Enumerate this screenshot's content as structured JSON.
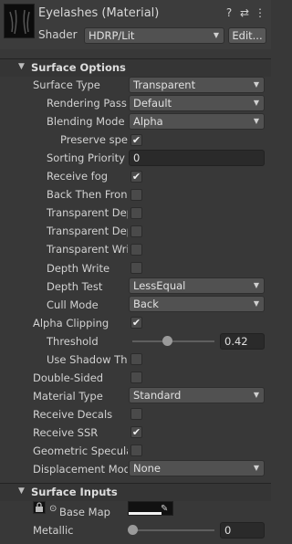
{
  "header": {
    "title": "Eyelashes (Material)",
    "help_icon": "?",
    "settings_icon": "⇄",
    "menu_icon": "⋮",
    "shader_label": "Shader",
    "shader_value": "HDRP/Lit",
    "edit_label": "Edit..."
  },
  "surface_options": {
    "title": "Surface Options",
    "surface_type": {
      "label": "Surface Type",
      "value": "Transparent"
    },
    "rendering_pass": {
      "label": "Rendering Pass",
      "value": "Default"
    },
    "blending_mode": {
      "label": "Blending Mode",
      "value": "Alpha"
    },
    "preserve_specular": {
      "label": "Preserve spe",
      "checked": true
    },
    "sorting_priority": {
      "label": "Sorting Priority",
      "value": "0"
    },
    "receive_fog": {
      "label": "Receive fog",
      "checked": true
    },
    "back_then_front": {
      "label": "Back Then Fron",
      "checked": false
    },
    "transparent_depth_prepass": {
      "label": "Transparent Dep",
      "checked": false
    },
    "transparent_depth_postpass": {
      "label": "Transparent Dep",
      "checked": false
    },
    "transparent_writes_motion": {
      "label": "Transparent Wri",
      "checked": false
    },
    "depth_write": {
      "label": "Depth Write",
      "checked": false
    },
    "depth_test": {
      "label": "Depth Test",
      "value": "LessEqual"
    },
    "cull_mode": {
      "label": "Cull Mode",
      "value": "Back"
    },
    "alpha_clipping": {
      "label": "Alpha Clipping",
      "checked": true
    },
    "threshold": {
      "label": "Threshold",
      "value": "0.42",
      "fraction": 0.42
    },
    "use_shadow_threshold": {
      "label": "Use Shadow Th",
      "checked": false
    },
    "double_sided": {
      "label": "Double-Sided",
      "checked": false
    },
    "material_type": {
      "label": "Material Type",
      "value": "Standard"
    },
    "receive_decals": {
      "label": "Receive Decals",
      "checked": false
    },
    "receive_ssr": {
      "label": "Receive SSR",
      "checked": true
    },
    "geometric_specular_aa": {
      "label": "Geometric Specula",
      "checked": false
    },
    "displacement_mode": {
      "label": "Displacement Mod",
      "value": "None"
    }
  },
  "surface_inputs": {
    "title": "Surface Inputs",
    "base_map": {
      "label": "Base Map",
      "icon": "lock-icon"
    },
    "metallic": {
      "label": "Metallic",
      "value": "0",
      "fraction": 0.0
    }
  },
  "glyphs": {
    "check": "✔",
    "arrow": "▼",
    "fold": "▼",
    "picker": "✎",
    "circle": "⊙"
  }
}
